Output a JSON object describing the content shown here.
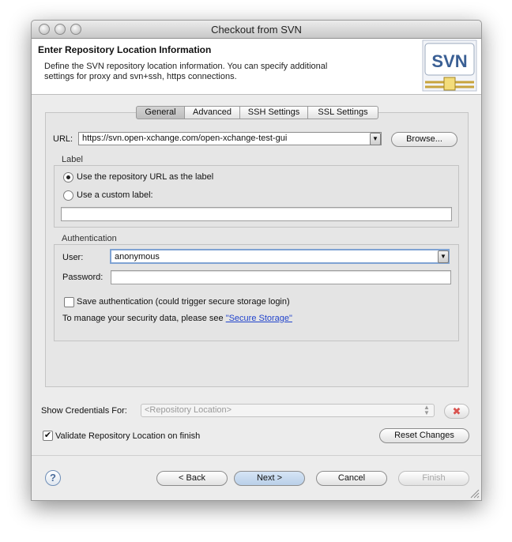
{
  "window": {
    "title": "Checkout from SVN"
  },
  "header": {
    "title": "Enter Repository Location Information",
    "description": "Define the SVN repository location information. You can specify additional settings for proxy and svn+ssh, https connections.",
    "logo_text": "SVN"
  },
  "tabs": [
    {
      "label": "General",
      "selected": true
    },
    {
      "label": "Advanced",
      "selected": false
    },
    {
      "label": "SSH Settings",
      "selected": false
    },
    {
      "label": "SSL Settings",
      "selected": false
    }
  ],
  "url": {
    "label": "URL:",
    "value": "https://svn.open-xchange.com/open-xchange-test-gui",
    "browse_label": "Browse..."
  },
  "label_group": {
    "title": "Label",
    "option_repo": "Use the repository URL as the label",
    "option_custom": "Use a custom label:",
    "selected": "repo",
    "custom_value": ""
  },
  "auth": {
    "title": "Authentication",
    "user_label": "User:",
    "user_value": "anonymous",
    "password_label": "Password:",
    "password_value": "",
    "save_label": "Save authentication (could trigger secure storage login)",
    "save_checked": false,
    "manage_text": "To manage your security data, please see",
    "manage_link": "\"Secure Storage\""
  },
  "credentials": {
    "label": "Show Credentials For:",
    "placeholder": "<Repository Location>"
  },
  "validate": {
    "label": "Validate Repository Location on finish",
    "checked": true
  },
  "buttons": {
    "reset": "Reset Changes",
    "help": "?",
    "back": "< Back",
    "next": "Next >",
    "cancel": "Cancel",
    "finish": "Finish"
  }
}
